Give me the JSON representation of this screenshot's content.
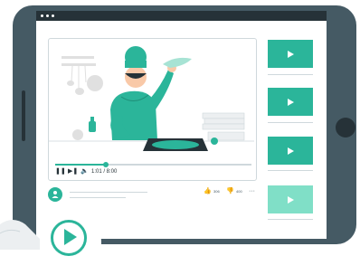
{
  "player": {
    "time": "1:01 / 8:00",
    "progress_fraction": 0.26,
    "play_pause_icon": "pause-icon",
    "skip_icon": "skip-forward-icon",
    "volume_icon": "volume-icon"
  },
  "channel": {
    "likes": "306",
    "dislikes": "400",
    "more": "···"
  },
  "playlist": {
    "items": [
      {
        "icon": "play-icon",
        "style": "solid"
      },
      {
        "icon": "play-icon",
        "style": "solid"
      },
      {
        "icon": "play-icon",
        "style": "solid"
      },
      {
        "icon": "play-icon",
        "style": "light"
      }
    ]
  },
  "colors": {
    "accent": "#2bb59a",
    "accent_light": "#80dfc7",
    "frame": "#455a64",
    "dark": "#263238"
  }
}
